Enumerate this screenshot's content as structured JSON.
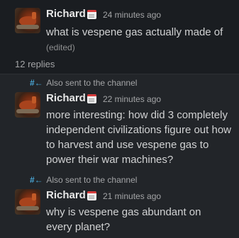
{
  "parent": {
    "author": "Richard",
    "time": "24 minutes ago",
    "text": "what is vespene gas actually made of",
    "edited": "(edited)"
  },
  "thread": {
    "replies_label": "12 replies",
    "messages": [
      {
        "sent_label": "Also sent to the channel",
        "author": "Richard",
        "time": "22 minutes ago",
        "text": "more interesting: how did 3 completely independent civilizations figure out how to harvest and use vespene gas to power their war machines?"
      },
      {
        "sent_label": "Also sent to the channel",
        "author": "Richard",
        "time": "21 minutes ago",
        "text": "why is vespene gas abundant on every planet?"
      }
    ]
  },
  "icons": {
    "status_emoji": "calendar-emoji-icon",
    "channel": "hash-arrow-icon"
  },
  "colors": {
    "background": "#1a1d21",
    "thread_background": "#222529",
    "channel_accent": "#4aa8d8"
  }
}
